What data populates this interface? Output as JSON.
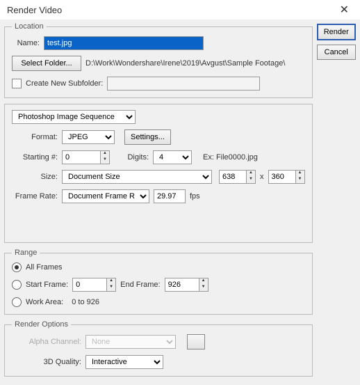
{
  "window": {
    "title": "Render Video",
    "close": "✕"
  },
  "buttons": {
    "render": "Render",
    "cancel": "Cancel"
  },
  "location": {
    "legend": "Location",
    "name_label": "Name:",
    "name_value": "test.jpg",
    "select_folder_btn": "Select Folder...",
    "path": "D:\\Work\\Wondershare\\Irene\\2019\\Avgust\\Sample Footage\\",
    "create_subfolder_label": "Create New Subfolder:",
    "subfolder_value": ""
  },
  "encode": {
    "preset": "Photoshop Image Sequence",
    "format_label": "Format:",
    "format_value": "JPEG",
    "settings_btn": "Settings...",
    "starting_label": "Starting #:",
    "starting_value": "0",
    "digits_label": "Digits:",
    "digits_value": "4",
    "example": "Ex: File0000.jpg",
    "size_label": "Size:",
    "size_preset": "Document Size",
    "width": "638",
    "x_label": "x",
    "height": "360",
    "framerate_label": "Frame Rate:",
    "framerate_preset": "Document Frame Rate",
    "framerate_value": "29.97",
    "fps_label": "fps"
  },
  "range": {
    "legend": "Range",
    "all_frames": "All Frames",
    "start_frame_label": "Start Frame:",
    "start_frame_value": "0",
    "end_frame_label": "End Frame:",
    "end_frame_value": "926",
    "work_area_label": "Work Area:",
    "work_area_value": "0 to 926"
  },
  "render_options": {
    "legend": "Render Options",
    "alpha_label": "Alpha Channel:",
    "alpha_value": "None",
    "quality_label": "3D Quality:",
    "quality_value": "Interactive"
  }
}
